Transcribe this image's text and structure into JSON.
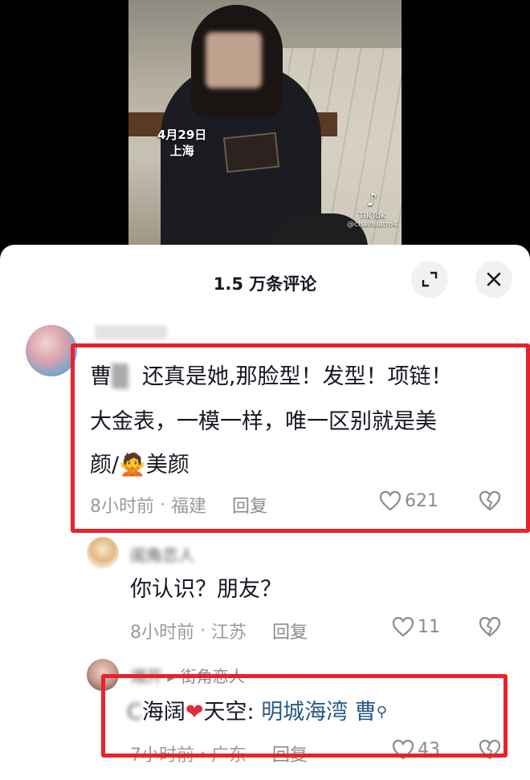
{
  "video": {
    "date_overlay": "4月29日",
    "location_overlay": "上海",
    "watermark": "TikTok",
    "watermark_handle": "@chaihuatro4"
  },
  "sheet": {
    "title": "1.5 万条评论",
    "expand_icon": "expand-icon",
    "close_icon": "close-icon"
  },
  "comments": [
    {
      "username": "",
      "name_prefix": "曹",
      "text_line1": "还真是她,那脸型！发型！项链！",
      "text_line2": "大金表，一模一样，唯一区别就是美",
      "text_line3": "颜/🙅美颜",
      "time": "8小时前",
      "region": "福建",
      "reply": "回复",
      "likes": "621"
    },
    {
      "username": "街角恋人",
      "text": "你认识？朋友？",
      "time": "8小时前",
      "region": "江苏",
      "reply": "回复",
      "likes": "11"
    },
    {
      "username": "街角恋人",
      "text_prefix": "海阔",
      "text_middle": "天空:",
      "text_link": "明城海湾 曹",
      "time": "7小时前",
      "region": "广东",
      "reply": "回复",
      "likes": "43"
    }
  ],
  "colors": {
    "highlight": "#e8222d",
    "link": "#2b5a8a",
    "heart": "#e02b3c"
  }
}
